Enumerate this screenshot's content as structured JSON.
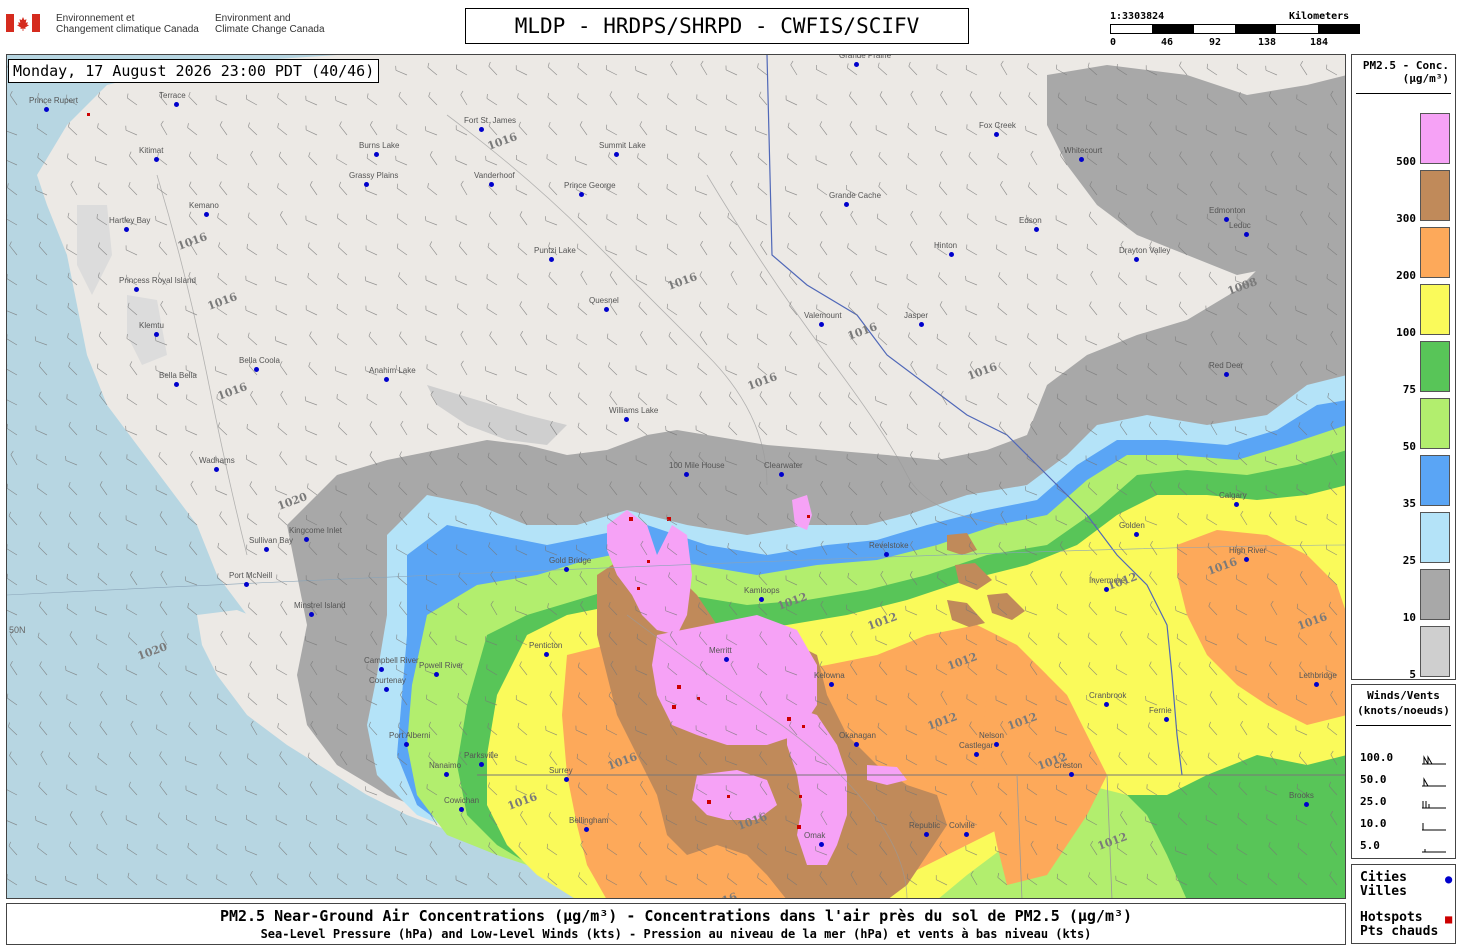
{
  "header": {
    "agency_fr": "Environnement et\nChangement climatique Canada",
    "agency_en": "Environment and\nClimate Change Canada",
    "title": "MLDP - HRDPS/SHRPD - CWFIS/SCIFV",
    "scale_ratio": "1:3303824",
    "scale_unit": "Kilometers",
    "scale_ticks": [
      "0",
      "46",
      "92",
      "138",
      "184"
    ]
  },
  "map": {
    "timestamp": "Monday, 17 August 2026 23:00 PDT (40/46)",
    "cities": [
      "Prince Rupert",
      "Terrace",
      "Kitimat",
      "Kemano",
      "Hartley Bay",
      "Princess Royal Island",
      "Klemtu",
      "Bella Bella",
      "Bella Coola",
      "Anahim Lake",
      "Burns Lake",
      "Grassy Plains",
      "Fort St. James",
      "Vanderhoof",
      "Prince George",
      "Summit Lake",
      "Grande Cache",
      "Grande Prairie",
      "Fox Creek",
      "Whitecourt",
      "Edmonton",
      "Edson",
      "Hinton",
      "Jasper",
      "Valemount",
      "Quesnel",
      "Puntzi Lake",
      "Williams Lake",
      "100 Mile House",
      "Clearwater",
      "Kamloops",
      "Merritt",
      "Gold Bridge",
      "Wadhams",
      "Sullivan Bay",
      "Kingcome Inlet",
      "Port McNeill",
      "Minstrel Island",
      "Campbell River",
      "Courtenay",
      "Powell River",
      "Port Alberni",
      "Parksville",
      "Nanaimo",
      "Cowichan",
      "Surrey",
      "Bellingham",
      "Penticton",
      "Kelowna",
      "Okanagan",
      "Omak",
      "Republic",
      "Colville",
      "Castlegar",
      "Nelson",
      "Cranbrook",
      "Fernie",
      "Creston",
      "Invermere",
      "Golden",
      "Revelstoke",
      "High River",
      "Calgary",
      "Red Deer",
      "Drayton Valley",
      "Leduc",
      "Lethbridge",
      "Brooks"
    ],
    "isobar_labels": [
      "1016",
      "1012",
      "1020",
      "1008"
    ],
    "graticule_label": "50N"
  },
  "legend": {
    "conc_title": "PM2.5 - Conc.\n(µg/m³)",
    "bins": [
      {
        "label": "500",
        "color": "#f6a2f6"
      },
      {
        "label": "300",
        "color": "#c08a5a"
      },
      {
        "label": "200",
        "color": "#fda95a"
      },
      {
        "label": "100",
        "color": "#fafa5a"
      },
      {
        "label": "75",
        "color": "#58c558"
      },
      {
        "label": "50",
        "color": "#b2ee6e"
      },
      {
        "label": "35",
        "color": "#5aa5f5"
      },
      {
        "label": "25",
        "color": "#b4e3f8"
      },
      {
        "label": "10",
        "color": "#a8a8a8"
      },
      {
        "label": "5",
        "color": "#cfcfcf"
      }
    ],
    "wind_title": "Winds/Vents\n(knots/noeuds)",
    "wind_rows": [
      "100.0",
      "50.0",
      "25.0",
      "10.0",
      "5.0"
    ],
    "cities_label": "Cities\nVilles",
    "cities_color": "#0000cc",
    "hotspots_label": "Hotspots\nPts chauds",
    "hotspots_color": "#cc0000"
  },
  "footer": {
    "line1": "PM2.5 Near-Ground Air Concentrations (µg/m³) - Concentrations dans l'air près du sol de PM2.5 (µg/m³)",
    "line2": "Sea-Level Pressure (hPa) and Low-Level Winds (kts) - Pression au niveau de la mer (hPa) et vents à bas niveau (kts)"
  }
}
